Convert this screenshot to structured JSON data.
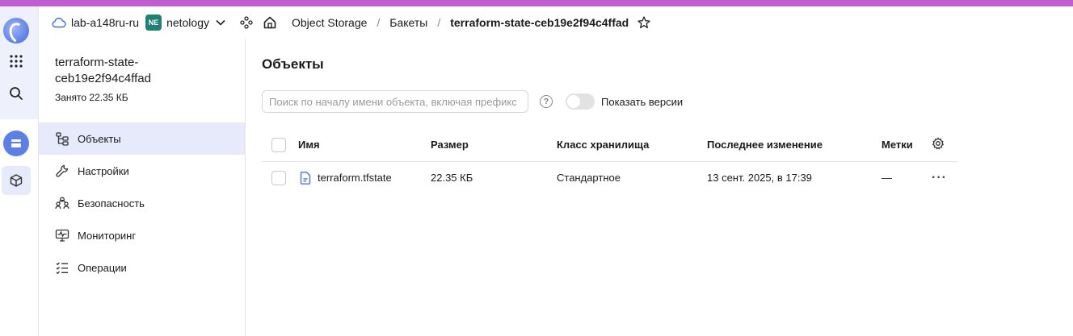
{
  "header": {
    "cloud_label": "lab-a148ru-ru",
    "org_badge": "NE",
    "org_name": "netology",
    "breadcrumbs": [
      "Object Storage",
      "Бакеты",
      "terraform-state-ceb19e2f94c4ffad"
    ],
    "separator": "/"
  },
  "sidebar": {
    "bucket_name": "terraform-state-ceb19e2f94c4ffad",
    "used": "Занято 22.35 КБ",
    "items": [
      {
        "label": "Объекты",
        "icon": "objects-icon",
        "active": true
      },
      {
        "label": "Настройки",
        "icon": "wrench-icon",
        "active": false
      },
      {
        "label": "Безопасность",
        "icon": "users-icon",
        "active": false
      },
      {
        "label": "Мониторинг",
        "icon": "monitor-icon",
        "active": false
      },
      {
        "label": "Операции",
        "icon": "list-icon",
        "active": false
      }
    ]
  },
  "main": {
    "title": "Объекты",
    "search_placeholder": "Поиск по началу имени объекта, включая префикс",
    "help_symbol": "?",
    "toggle_label": "Показать версии",
    "columns": [
      "Имя",
      "Размер",
      "Класс хранилища",
      "Последнее изменение",
      "Метки"
    ],
    "rows": [
      {
        "name": "terraform.tfstate",
        "size": "22.35 КБ",
        "storage_class": "Стандартное",
        "modified": "13 сент. 2025, в 17:39",
        "labels": "—",
        "actions": "···"
      }
    ]
  },
  "colors": {
    "accent": "#5b7fe8",
    "active_bg": "#e7eafb",
    "badge": "#1f8075",
    "top_strip": "#c05dd0"
  }
}
